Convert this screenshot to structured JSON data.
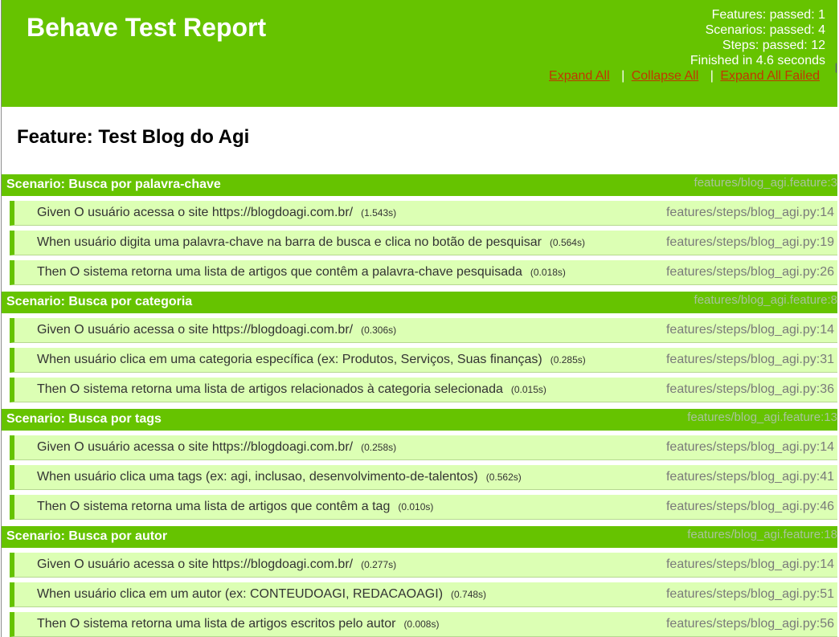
{
  "header": {
    "title": "Behave Test Report",
    "summary": [
      "Features: passed: 1",
      "Scenarios: passed: 4",
      "Steps: passed: 12",
      "Finished in 4.6 seconds"
    ],
    "controls": {
      "expand_all": "Expand All",
      "collapse_all": "Collapse All",
      "expand_all_failed": "Expand All Failed",
      "separator": "|"
    }
  },
  "feature": {
    "title": "Feature: Test Blog do Agi"
  },
  "colors": {
    "passed_header": "#66c300",
    "step_background": "#dcffb4",
    "link": "#c03800"
  },
  "scenarios": [
    {
      "name": "Scenario: Busca por palavra-chave",
      "location": "features/blog_agi.feature:3",
      "steps": [
        {
          "text": "Given O usuário acessa o site https://blogdoagi.com.br/",
          "duration": "(1.543s)",
          "location": "features/steps/blog_agi.py:14"
        },
        {
          "text": "When usuário digita uma palavra-chave na barra de busca e clica no botão de pesquisar",
          "duration": "(0.564s)",
          "location": "features/steps/blog_agi.py:19"
        },
        {
          "text": "Then O sistema retorna uma lista de artigos que contêm a palavra-chave pesquisada",
          "duration": "(0.018s)",
          "location": "features/steps/blog_agi.py:26"
        }
      ]
    },
    {
      "name": "Scenario: Busca por categoria",
      "location": "features/blog_agi.feature:8",
      "steps": [
        {
          "text": "Given O usuário acessa o site https://blogdoagi.com.br/",
          "duration": "(0.306s)",
          "location": "features/steps/blog_agi.py:14"
        },
        {
          "text": "When usuário clica em uma categoria específica (ex: Produtos, Serviços, Suas finanças)",
          "duration": "(0.285s)",
          "location": "features/steps/blog_agi.py:31"
        },
        {
          "text": "Then O sistema retorna uma lista de artigos relacionados à categoria selecionada",
          "duration": "(0.015s)",
          "location": "features/steps/blog_agi.py:36"
        }
      ]
    },
    {
      "name": "Scenario: Busca por tags",
      "location": "features/blog_agi.feature:13",
      "steps": [
        {
          "text": "Given O usuário acessa o site https://blogdoagi.com.br/",
          "duration": "(0.258s)",
          "location": "features/steps/blog_agi.py:14"
        },
        {
          "text": "When usuário clica uma tags (ex: agi, inclusao, desenvolvimento-de-talentos)",
          "duration": "(0.562s)",
          "location": "features/steps/blog_agi.py:41"
        },
        {
          "text": "Then O sistema retorna uma lista de artigos que contêm a tag",
          "duration": "(0.010s)",
          "location": "features/steps/blog_agi.py:46"
        }
      ]
    },
    {
      "name": "Scenario: Busca por autor",
      "location": "features/blog_agi.feature:18",
      "steps": [
        {
          "text": "Given O usuário acessa o site https://blogdoagi.com.br/",
          "duration": "(0.277s)",
          "location": "features/steps/blog_agi.py:14"
        },
        {
          "text": "When usuário clica em um autor (ex: CONTEUDOAGI, REDACAOAGI)",
          "duration": "(0.748s)",
          "location": "features/steps/blog_agi.py:51"
        },
        {
          "text": "Then O sistema retorna uma lista de artigos escritos pelo autor",
          "duration": "(0.008s)",
          "location": "features/steps/blog_agi.py:56"
        }
      ]
    }
  ]
}
